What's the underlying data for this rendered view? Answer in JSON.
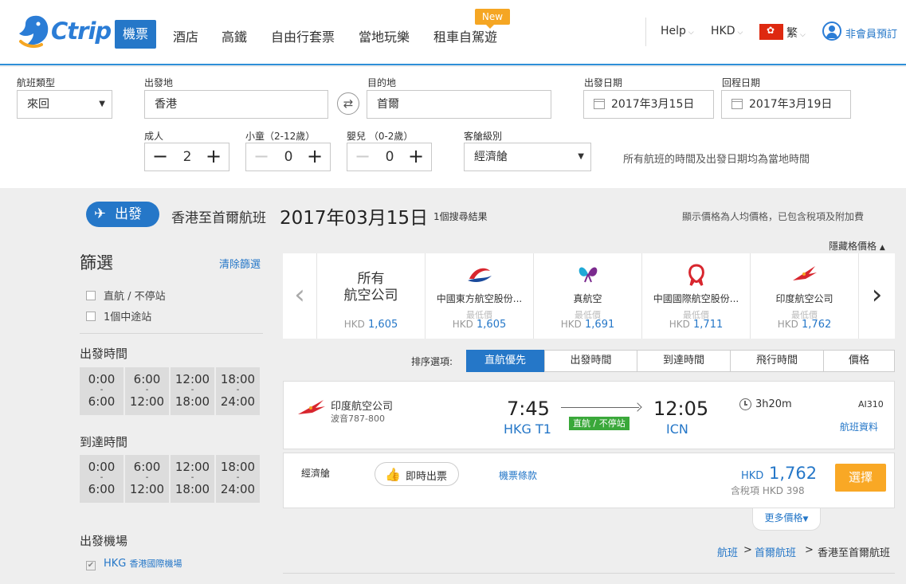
{
  "header": {
    "logo": "Ctrip",
    "nav": [
      {
        "label": "機票",
        "active": true
      },
      {
        "label": "酒店"
      },
      {
        "label": "高鐵"
      },
      {
        "label": "自由行套票"
      },
      {
        "label": "當地玩樂"
      },
      {
        "label": "租車自駕遊",
        "badge": "New"
      }
    ],
    "help": "Help",
    "currency": "HKD",
    "language": "繁",
    "account": "非會員預訂"
  },
  "search": {
    "trip_type": {
      "label": "航班類型",
      "value": "來回"
    },
    "from": {
      "label": "出發地",
      "value": "香港"
    },
    "to": {
      "label": "目的地",
      "value": "首爾"
    },
    "depart_date": {
      "label": "出發日期",
      "value": "2017年3月15日"
    },
    "return_date": {
      "label": "回程日期",
      "value": "2017年3月19日"
    },
    "adults": {
      "label": "成人",
      "value": "2"
    },
    "children": {
      "label": "小童（2-12歲）",
      "value": "0"
    },
    "infants": {
      "label": "嬰兒 （0-2歲）",
      "value": "0"
    },
    "cabin": {
      "label": "客艙級別",
      "value": "經濟艙"
    },
    "note": "所有航班的時間及出發日期均為當地時間"
  },
  "results_header": {
    "direction": "出發",
    "route": "香港至首爾航班",
    "date": "2017年03月15日",
    "count": "1個搜尋結果",
    "price_note": "顯示價格為人均價格，已包含稅項及附加費",
    "hide_grid": "隱藏格價格"
  },
  "filters": {
    "title": "篩選",
    "clear": "清除篩選",
    "stops": [
      "直航 / 不停站",
      "1個中途站"
    ],
    "depart_time": {
      "title": "出發時間",
      "slots": [
        {
          "from": "0:00",
          "sep": "-",
          "to": "6:00"
        },
        {
          "from": "6:00",
          "sep": "-",
          "to": "12:00"
        },
        {
          "from": "12:00",
          "sep": "-",
          "to": "18:00"
        },
        {
          "from": "18:00",
          "sep": "-",
          "to": "24:00"
        }
      ]
    },
    "arrive_time": {
      "title": "到達時間",
      "slots": [
        {
          "from": "0:00",
          "sep": "-",
          "to": "6:00"
        },
        {
          "from": "6:00",
          "sep": "-",
          "to": "12:00"
        },
        {
          "from": "12:00",
          "sep": "-",
          "to": "18:00"
        },
        {
          "from": "18:00",
          "sep": "-",
          "to": "24:00"
        }
      ]
    },
    "airport": {
      "title": "出發機場",
      "code": "HKG",
      "name": "香港國際機場"
    }
  },
  "airlines": {
    "all": {
      "line1": "所有",
      "line2": "航空公司",
      "currency": "HKD",
      "price": "1,605"
    },
    "items": [
      {
        "name": "中國東方航空股份...",
        "low_label": "最低價",
        "currency": "HKD",
        "price": "1,605",
        "logo": "china-eastern-logo",
        "color": "#d8262e"
      },
      {
        "name": "真航空",
        "low_label": "最低價",
        "currency": "HKD",
        "price": "1,691",
        "logo": "jin-air-logo",
        "color": "#1fa9d6"
      },
      {
        "name": "中國國際航空股份...",
        "low_label": "最低價",
        "currency": "HKD",
        "price": "1,711",
        "logo": "air-china-logo",
        "color": "#d8262e"
      },
      {
        "name": "印度航空公司",
        "low_label": "最低價",
        "currency": "HKD",
        "price": "1,762",
        "logo": "air-india-logo",
        "color": "#d8262e"
      }
    ]
  },
  "sort": {
    "label": "排序選項:",
    "options": [
      "直航優先",
      "出發時間",
      "到達時間",
      "飛行時間",
      "價格"
    ],
    "active": "直航優先"
  },
  "flight": {
    "airline": "印度航空公司",
    "aircraft": "波音787-800",
    "depart_time": "7:45",
    "depart_airport": "HKG T1",
    "arrive_time": "12:05",
    "arrive_airport": "ICN",
    "nonstop": "直航 / 不停站",
    "duration": "3h20m",
    "flight_no": "AI310",
    "info_link": "航班資料",
    "cabin": "經濟艙",
    "instant": "即時出票",
    "terms": "機票條款",
    "currency": "HKD",
    "price": "1,762",
    "tax_note": "含稅項 HKD 398",
    "select": "選擇",
    "more_prices": "更多價格"
  },
  "breadcrumb": [
    "航班",
    "首爾航班",
    "香港至首爾航班"
  ]
}
